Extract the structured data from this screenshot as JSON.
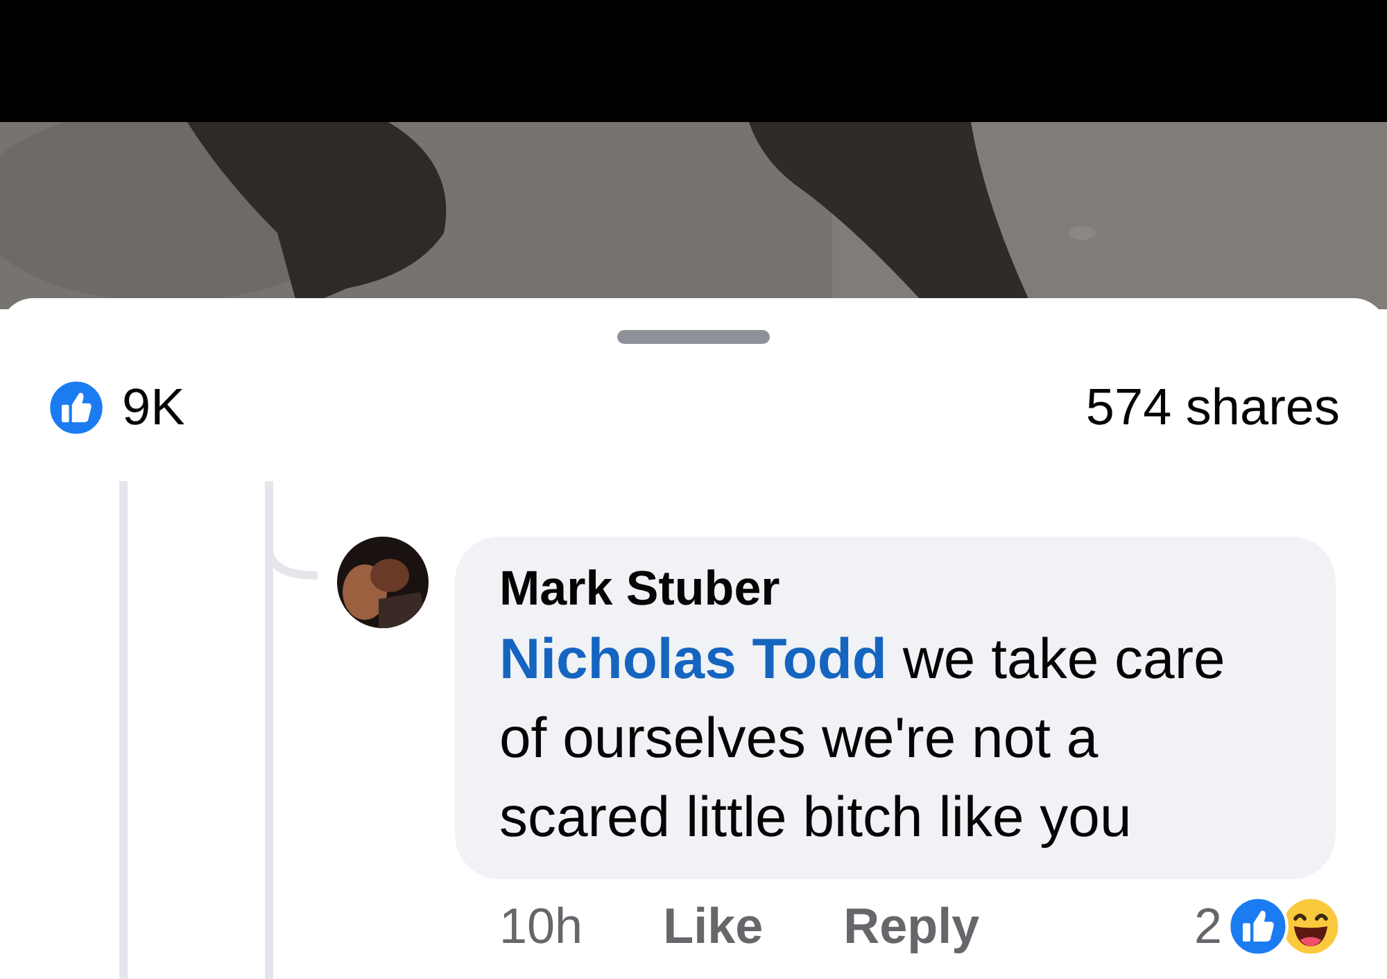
{
  "reactions": {
    "count": "9K",
    "shares": "574 shares"
  },
  "comment": {
    "author": "Mark Stuber",
    "mention": "Nicholas Todd",
    "text": "we take care of ourselves we're not a scared little bitch like you",
    "time": "10h",
    "actions": [
      "Like",
      "Reply"
    ],
    "reaction_count": "2"
  }
}
